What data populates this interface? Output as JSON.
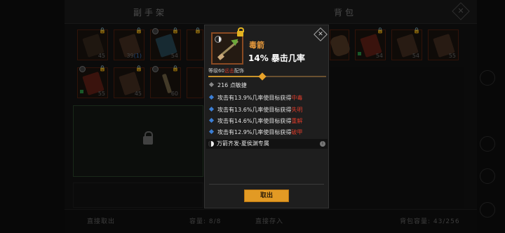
{
  "header": {
    "left_title": "副手架",
    "right_title": "背包",
    "close_icon": "close-icon"
  },
  "shelf_slots": [
    {
      "count": "45"
    },
    {
      "count": "39"
    },
    {
      "count": "54"
    },
    {
      "count": ""
    },
    {
      "count": "55"
    },
    {
      "count": "45"
    },
    {
      "count": "60"
    },
    {
      "count": ""
    }
  ],
  "shelf_slot_extra": {
    "slot2_suffix": "(1)"
  },
  "bag_slots": [
    {
      "count": "54"
    },
    {
      "count": "54"
    },
    {
      "count": "56"
    },
    {
      "count": "55"
    }
  ],
  "popup": {
    "item_name": "毒箭",
    "main_stat": "14% 暴击几率",
    "req_level": "等级60",
    "req_class": "远击",
    "req_type": "配饰",
    "progress": 0.46,
    "base_stat": "216 点敏捷",
    "effects": [
      {
        "prefix": "攻击有13.9%几率使目标获得",
        "status": "中毒"
      },
      {
        "prefix": "攻击有13.6%几率使目标获得",
        "status": "失明"
      },
      {
        "prefix": "攻击有14.6%几率使目标获得",
        "status": "重解"
      },
      {
        "prefix": "攻击有12.9%几率使目标获得",
        "status": "破甲"
      }
    ],
    "set_bonus": "万箭齐发-夏侯渊专属",
    "button_label": "取出"
  },
  "footer": {
    "take_out": "直接取出",
    "capacity": "容量: 8/8",
    "deposit": "直接存入",
    "bag_capacity": "背包容量: 43/256"
  },
  "colors": {
    "item_name": "#e89a3c",
    "effect_status": "#d63b2a",
    "button": "#e29a24",
    "effect_bullet": "#3b7fd6"
  }
}
